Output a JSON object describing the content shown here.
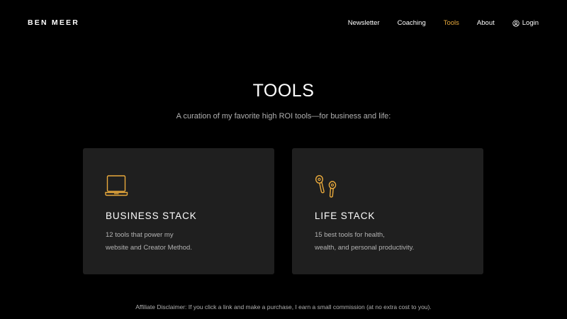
{
  "header": {
    "logo": "BEN MEER",
    "nav": [
      {
        "label": "Newsletter"
      },
      {
        "label": "Coaching"
      },
      {
        "label": "Tools",
        "active": true
      },
      {
        "label": "About"
      },
      {
        "label": "Login",
        "icon": "user-circle-icon"
      }
    ]
  },
  "hero": {
    "title": "TOOLS",
    "subtitle": "A curation of my favorite high ROI tools—for business and life:"
  },
  "cards": [
    {
      "icon": "laptop-icon",
      "title": "BUSINESS STACK",
      "desc_line1": "12 tools that power my",
      "desc_line2": "website and Creator Method."
    },
    {
      "icon": "earbuds-icon",
      "title": "LIFE STACK",
      "desc_line1": "15 best tools for health,",
      "desc_line2": "wealth, and personal productivity."
    }
  ],
  "footer": {
    "disclaimer": "Affiliate Disclaimer: If you click a link and make a purchase, I earn a small commission (at no extra cost to you)."
  },
  "colors": {
    "background": "#000000",
    "card": "#1f1f1f",
    "accent": "#e8a93c",
    "muted_text": "#b0b0b0"
  }
}
